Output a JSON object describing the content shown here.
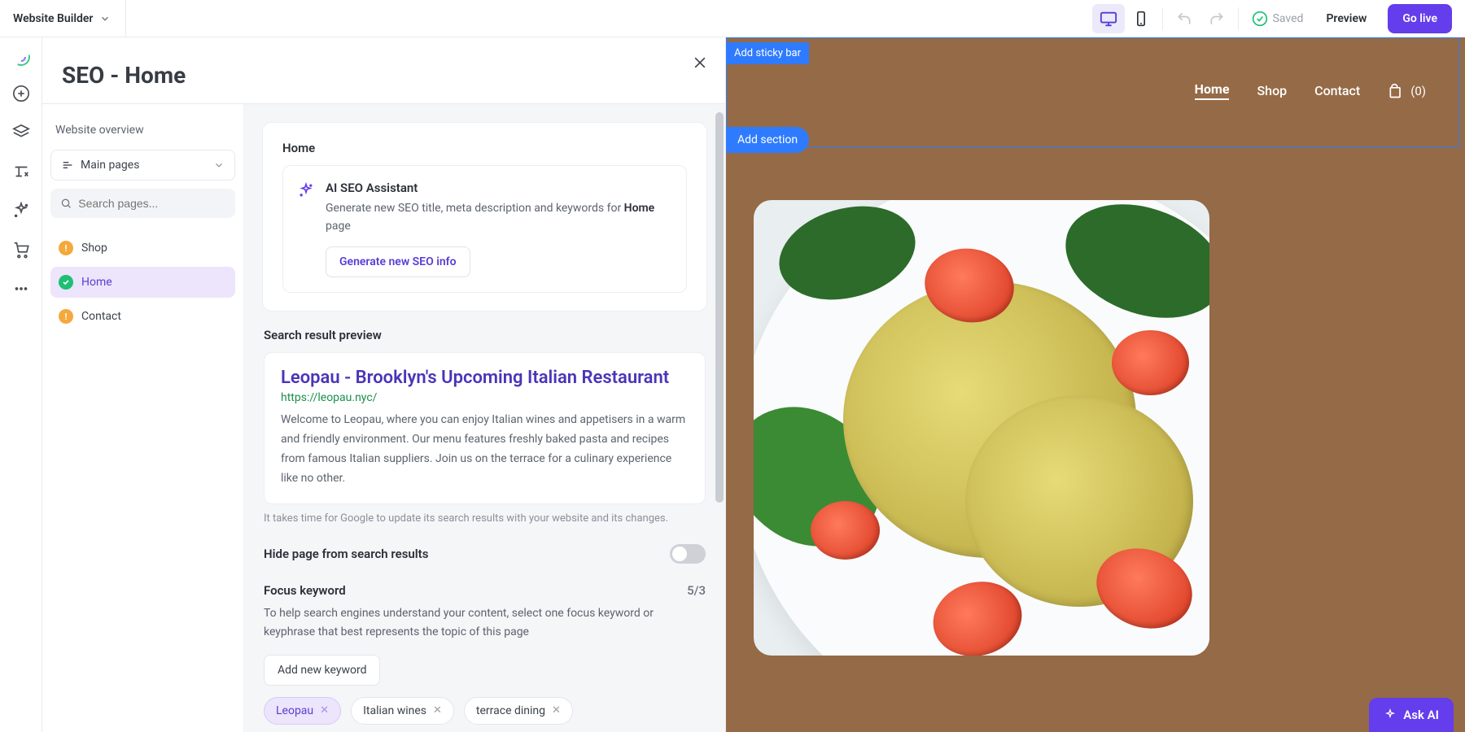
{
  "topbar": {
    "brand": "Website Builder",
    "saved": "Saved",
    "preview": "Preview",
    "golive": "Go live"
  },
  "seo": {
    "title": "SEO - Home",
    "overview": "Website overview",
    "mainpages_label": "Main pages",
    "search_placeholder": "Search pages...",
    "pages": [
      {
        "label": "Shop",
        "status": "orange"
      },
      {
        "label": "Home",
        "status": "green",
        "active": true
      },
      {
        "label": "Contact",
        "status": "orange"
      }
    ],
    "content": {
      "home_heading": "Home",
      "ai_title": "AI SEO Assistant",
      "ai_desc_pre": "Generate new SEO title, meta description and keywords for ",
      "ai_desc_bold": "Home",
      "ai_desc_post": " page",
      "ai_btn": "Generate new SEO info",
      "preview_heading": "Search result preview",
      "serp_title": "Leopau - Brooklyn's Upcoming Italian Restaurant",
      "serp_url": "https://leopau.nyc/",
      "serp_desc": "Welcome to Leopau, where you can enjoy Italian wines and appetisers in a warm and friendly environment. Our menu features freshly baked pasta and recipes from famous Italian suppliers. Join us on the terrace for a culinary experience like no other.",
      "preview_note": "It takes time for Google to update its search results with your website and its changes.",
      "hide_label": "Hide page from search results",
      "fk_heading": "Focus keyword",
      "fk_count": "5/3",
      "fk_desc": "To help search engines understand your content, select one focus keyword or keyphrase that best represents the topic of this page",
      "add_keyword_btn": "Add new keyword",
      "keywords": [
        {
          "label": "Leopau",
          "active": true
        },
        {
          "label": "Italian wines"
        },
        {
          "label": "terrace dining"
        }
      ]
    }
  },
  "canvas": {
    "sticky_btn": "Add sticky bar",
    "add_section": "Add section",
    "nav": {
      "home": "Home",
      "shop": "Shop",
      "contact": "Contact",
      "cart_count": "(0)"
    },
    "askai": "Ask AI"
  }
}
